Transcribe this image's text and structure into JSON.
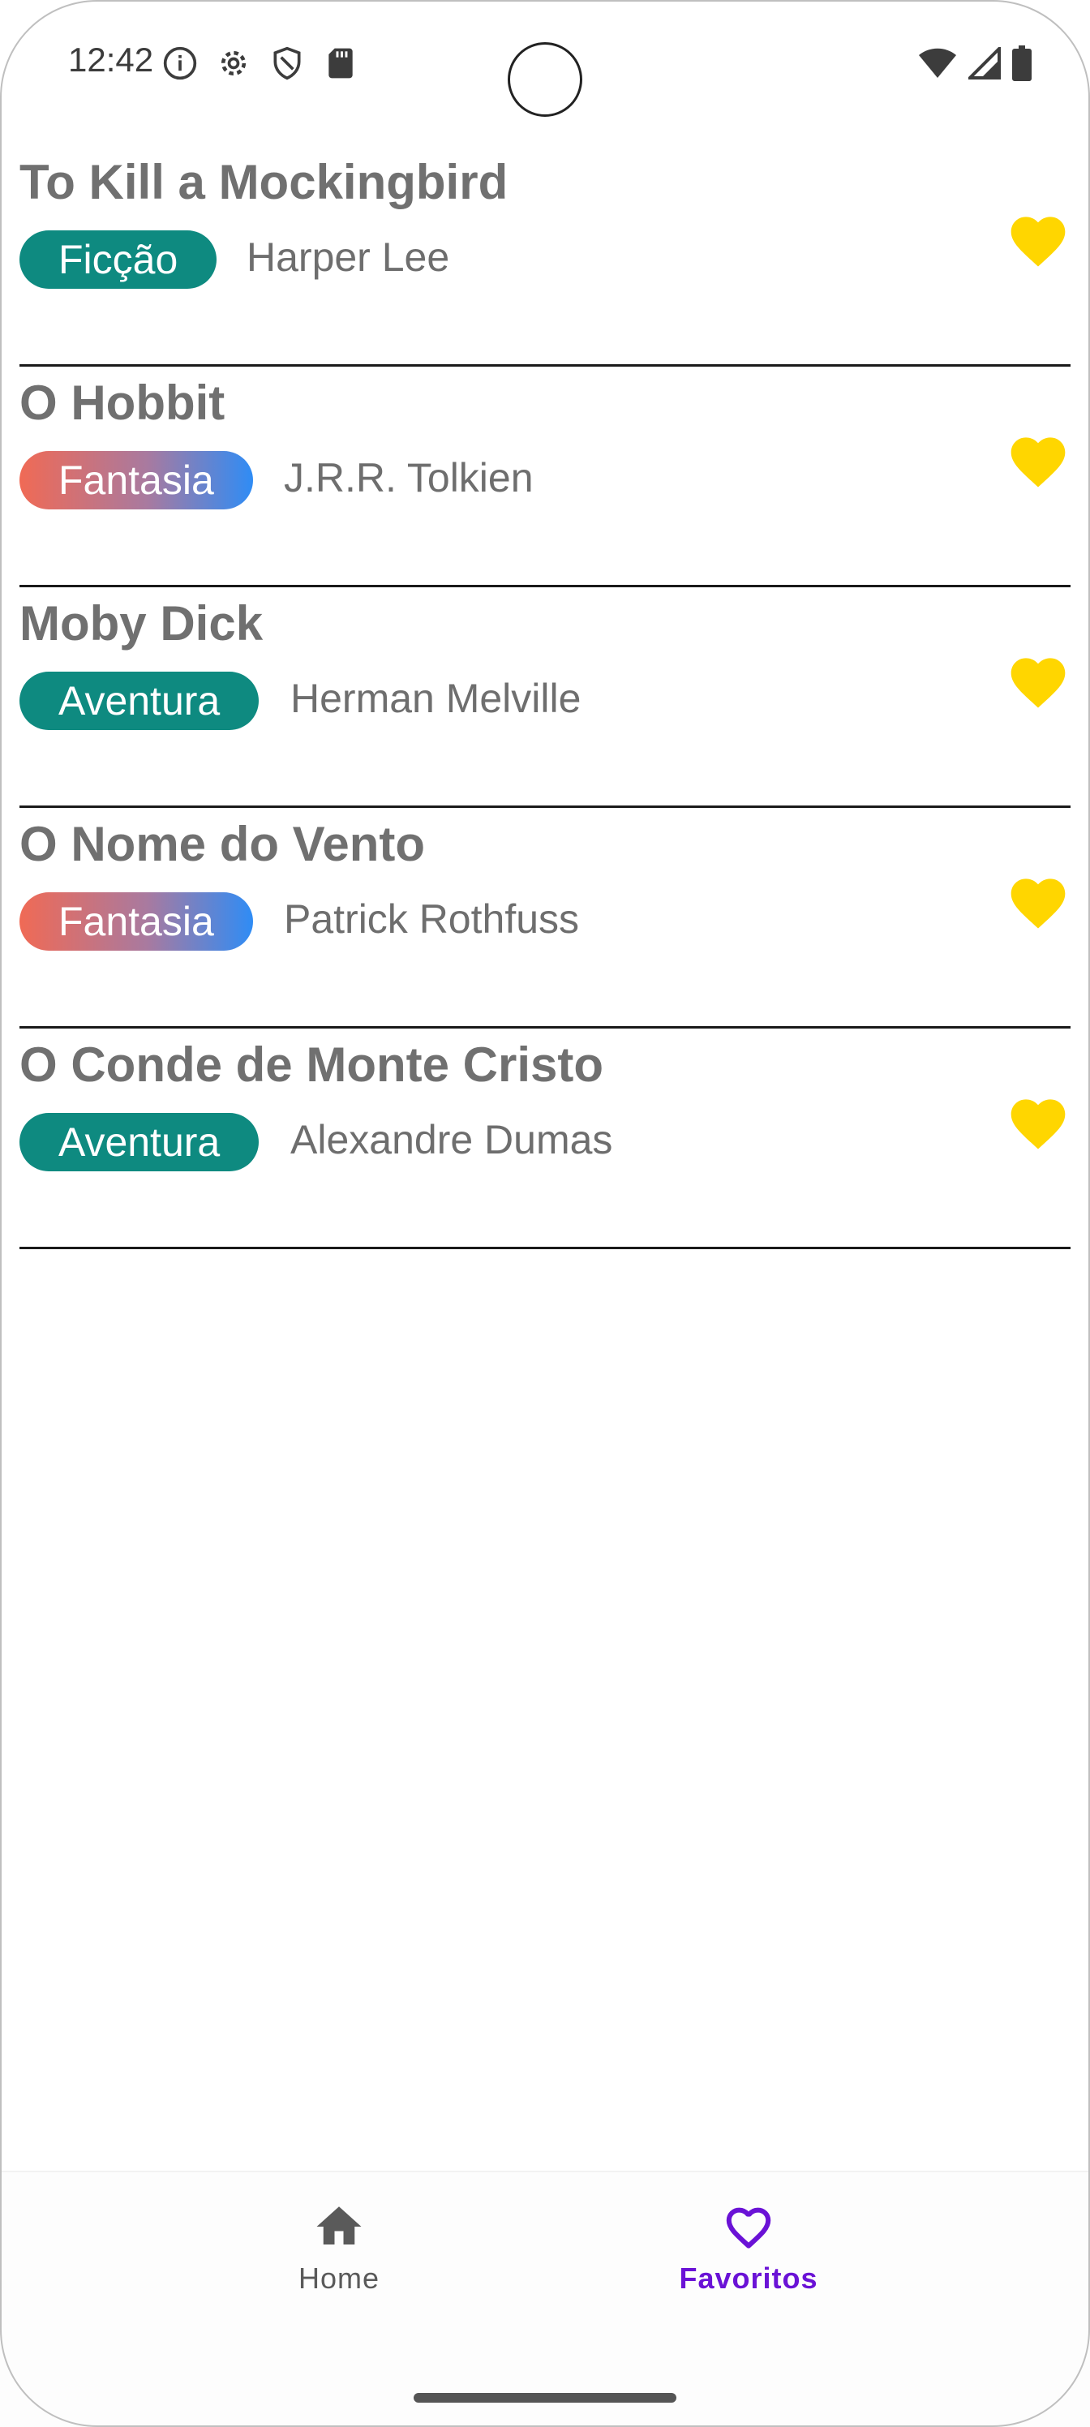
{
  "status_bar": {
    "time": "12:42",
    "left_icons": [
      "info-icon",
      "settings-icon",
      "shield-icon",
      "sd-card-icon"
    ],
    "right_icons": [
      "wifi-icon",
      "cell-signal-icon",
      "battery-icon"
    ]
  },
  "books": [
    {
      "title": "To Kill a Mockingbird",
      "genre": "Ficção",
      "author": "Harper Lee",
      "chip_style": "teal",
      "favorite": true
    },
    {
      "title": "O Hobbit",
      "genre": "Fantasia",
      "author": "J.R.R. Tolkien",
      "chip_style": "gradient",
      "favorite": true
    },
    {
      "title": "Moby Dick",
      "genre": "Aventura",
      "author": "Herman Melville",
      "chip_style": "teal",
      "favorite": true
    },
    {
      "title": "O Nome do Vento",
      "genre": "Fantasia",
      "author": "Patrick Rothfuss",
      "chip_style": "gradient",
      "favorite": true
    },
    {
      "title": "O Conde de Monte Cristo",
      "genre": "Aventura",
      "author": "Alexandre Dumas",
      "chip_style": "teal",
      "favorite": true
    }
  ],
  "bottom_nav": {
    "home_label": "Home",
    "favorites_label": "Favoritos",
    "active": "favorites"
  },
  "colors": {
    "heart": "#FFD600",
    "chip_teal": "#0E8A80",
    "chip_gradient_start": "#F06A55",
    "chip_gradient_end": "#2F8CF5",
    "active_nav": "#6A12D6"
  }
}
